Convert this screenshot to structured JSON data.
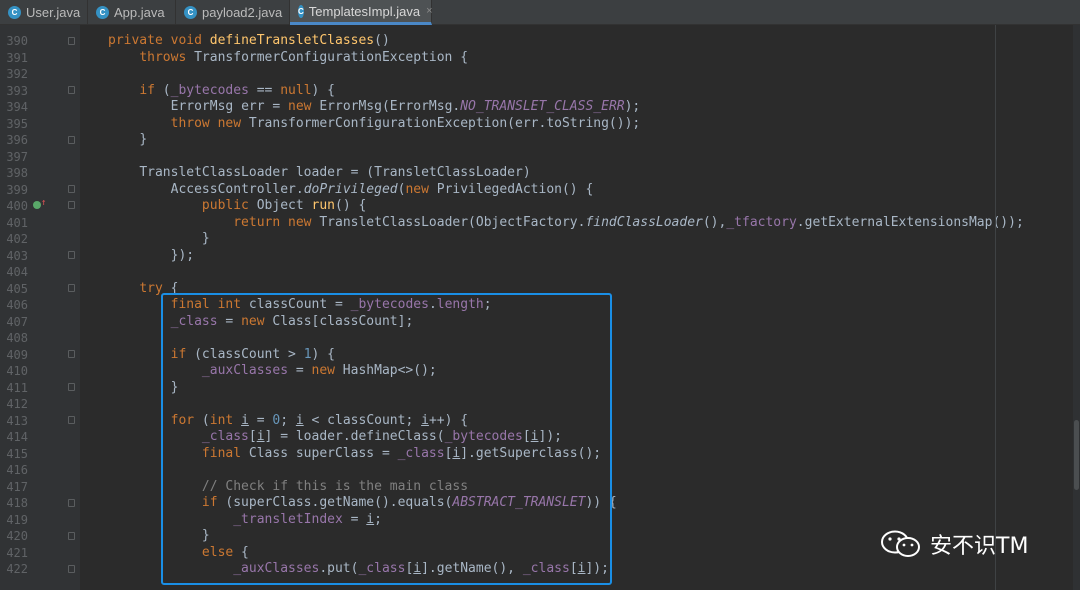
{
  "tabs": [
    {
      "label": "User.java",
      "icon": "java-class-icon",
      "icon_color": "#3592c4",
      "icon_char": "C",
      "active": false
    },
    {
      "label": "App.java",
      "icon": "java-class-icon",
      "icon_color": "#3592c4",
      "icon_char": "C",
      "active": false
    },
    {
      "label": "payload2.java",
      "icon": "java-class-icon",
      "icon_color": "#3592c4",
      "icon_char": "C",
      "active": false
    },
    {
      "label": "TemplatesImpl.java",
      "icon": "java-class-icon",
      "icon_color": "#3592c4",
      "icon_char": "C",
      "active": true
    }
  ],
  "tab_close": "×",
  "gutter": {
    "line_numbers": [
      "390",
      "391",
      "392",
      "393",
      "394",
      "395",
      "396",
      "397",
      "398",
      "399",
      "400",
      "401",
      "402",
      "403",
      "404",
      "405",
      "406",
      "407",
      "408",
      "409",
      "410",
      "411",
      "412",
      "413",
      "414",
      "415",
      "416",
      "417",
      "418",
      "419",
      "420",
      "421",
      "422"
    ]
  },
  "code": {
    "l390": {
      "t1": "private",
      "t2": "void",
      "t3": "defineTransletClasses",
      "t4": "()"
    },
    "l391": {
      "t1": "throws",
      "t2": " TransformerConfigurationException {"
    },
    "l393": {
      "t1": "if",
      "t2": " (",
      "t3": "_bytecodes",
      "t4": " == ",
      "t5": "null",
      "t6": ") {"
    },
    "l394": {
      "t1": "ErrorMsg err = ",
      "t2": "new",
      "t3": " ErrorMsg(ErrorMsg.",
      "t4": "NO_TRANSLET_CLASS_ERR",
      "t5": ");"
    },
    "l395": {
      "t1": "throw",
      "t2": " ",
      "t3": "new",
      "t4": " TransformerConfigurationException(err.toString());"
    },
    "l396": {
      "t1": "}"
    },
    "l398": {
      "t1": "TransletClassLoader loader = (TransletClassLoader)"
    },
    "l399": {
      "t1": "AccessController.",
      "t2": "doPrivileged",
      "t3": "(",
      "t4": "new",
      "t5": " PrivilegedAction() {"
    },
    "l400": {
      "t1": "public",
      "t2": " Object ",
      "t3": "run",
      "t4": "() {"
    },
    "l401": {
      "t1": "return",
      "t2": " ",
      "t3": "new",
      "t4": " TransletClassLoader(ObjectFactory.",
      "t5": "findClassLoader",
      "t6": "(),",
      "t7": "_tfactory",
      "t8": ".getExternalExtensionsMap());"
    },
    "l402": {
      "t1": "}"
    },
    "l403": {
      "t1": "});"
    },
    "l405": {
      "t1": "try",
      "t2": " {"
    },
    "l406": {
      "t1": "final",
      "t2": " ",
      "t3": "int",
      "t4": " classCount = ",
      "t5": "_bytecodes",
      "t6": ".",
      "t7": "length",
      "t8": ";"
    },
    "l407": {
      "t1": "_class",
      "t2": " = ",
      "t3": "new",
      "t4": " Class[classCount];"
    },
    "l409": {
      "t1": "if",
      "t2": " (classCount > ",
      "t3": "1",
      "t4": ") {"
    },
    "l410": {
      "t1": "_auxClasses",
      "t2": " = ",
      "t3": "new",
      "t4": " HashMap<>();"
    },
    "l411": {
      "t1": "}"
    },
    "l413": {
      "t1": "for",
      "t2": " (",
      "t3": "int",
      "t4": " ",
      "t5": "i",
      "t6": " = ",
      "t7": "0",
      "t8": "; ",
      "t9": "i",
      "t10": " < classCount; ",
      "t11": "i",
      "t12": "++) {"
    },
    "l414": {
      "t1": "_class",
      "t2": "[",
      "t3": "i",
      "t4": "] = loader.defineClass(",
      "t5": "_bytecodes",
      "t6": "[",
      "t7": "i",
      "t8": "]);"
    },
    "l415": {
      "t1": "final",
      "t2": " Class superClass = ",
      "t3": "_class",
      "t4": "[",
      "t5": "i",
      "t6": "].getSuperclass();"
    },
    "l417": {
      "t1": "// Check if this is the main class"
    },
    "l418": {
      "t1": "if",
      "t2": " (superClass.getName().equals(",
      "t3": "ABSTRACT_TRANSLET",
      "t4": ")) {"
    },
    "l419": {
      "t1": "_transletIndex",
      "t2": " = ",
      "t3": "i",
      "t4": ";"
    },
    "l420": {
      "t1": "}"
    },
    "l421": {
      "t1": "else",
      "t2": " {"
    },
    "l422": {
      "t1": "_auxClasses",
      "t2": ".put(",
      "t3": "_class",
      "t4": "[",
      "t5": "i",
      "t6": "].getName(), ",
      "t7": "_class",
      "t8": "[",
      "t9": "i",
      "t10": "]);"
    }
  },
  "watermark": {
    "text": "安不识TM",
    "icon": "wechat-icon"
  }
}
